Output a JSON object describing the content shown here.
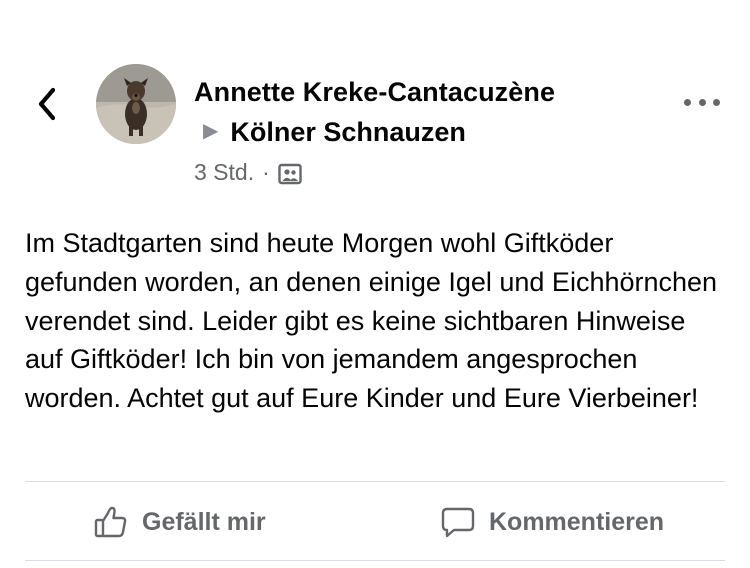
{
  "post": {
    "author": "Annette Kreke-Cantacuzène",
    "group": "Kölner Schnauzen",
    "time": "3 Std.",
    "separator": "·",
    "audience_icon": "group-audience-icon",
    "text": "Im Stadtgarten sind heute Morgen wohl Giftköder gefunden worden, an denen einige Igel und Eichhörnchen verendet sind. Leider gibt es keine sichtbaren Hinweise auf Giftköder! Ich bin von jemandem angesprochen worden. Achtet gut auf Eure Kinder und Eure Vierbeiner!"
  },
  "actions": {
    "like_label": "Gefällt mir",
    "comment_label": "Kommentieren"
  },
  "icons": {
    "back": "chevron-left-icon",
    "more": "more-dots-icon",
    "like": "thumbs-up-icon",
    "comment": "comment-bubble-icon",
    "group_arrow": "triangle-right-icon"
  },
  "colors": {
    "text_primary": "#050505",
    "text_secondary": "#65676b",
    "divider": "#dadde1"
  }
}
